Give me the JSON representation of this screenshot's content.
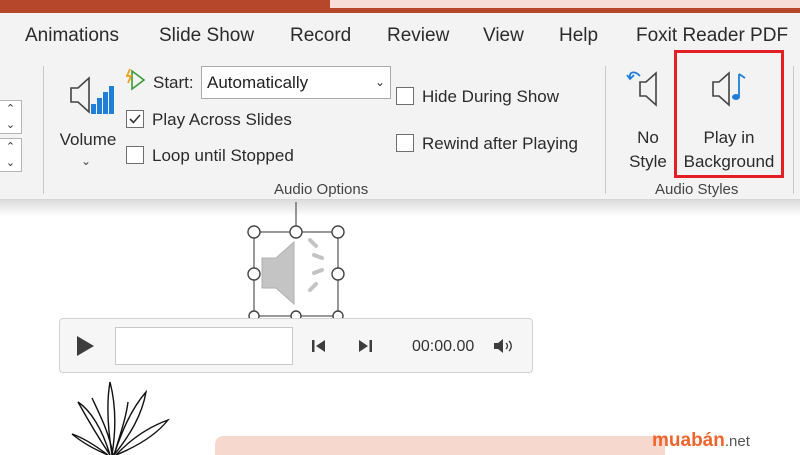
{
  "colors": {
    "titlebar": "#b7472a",
    "accent_blue": "#1f7ed8",
    "highlight_red": "#e32024",
    "watermark_orange": "#f0642e"
  },
  "tabs": [
    "Animations",
    "Slide Show",
    "Record",
    "Review",
    "View",
    "Help",
    "Foxit Reader PDF"
  ],
  "ribbon": {
    "volume": {
      "label": "Volume",
      "icon": "speaker-volume-bars-icon"
    },
    "start": {
      "label": "Start:",
      "selected": "Automatically"
    },
    "checkboxes": {
      "play_across_slides": {
        "label": "Play Across Slides",
        "checked": true
      },
      "loop_until_stopped": {
        "label": "Loop until Stopped",
        "checked": false
      },
      "hide_during_show": {
        "label": "Hide During Show",
        "checked": false
      },
      "rewind_after_playing": {
        "label": "Rewind after Playing",
        "checked": false
      }
    },
    "audio_options_label": "Audio Options",
    "no_style": {
      "line1": "No",
      "line2": "Style"
    },
    "play_in_background": {
      "line1": "Play in",
      "line2": "Background"
    },
    "audio_styles_label": "Audio Styles"
  },
  "player": {
    "time": "00:00.00"
  },
  "watermark": {
    "brand": "muabán",
    "tld": ".net"
  }
}
